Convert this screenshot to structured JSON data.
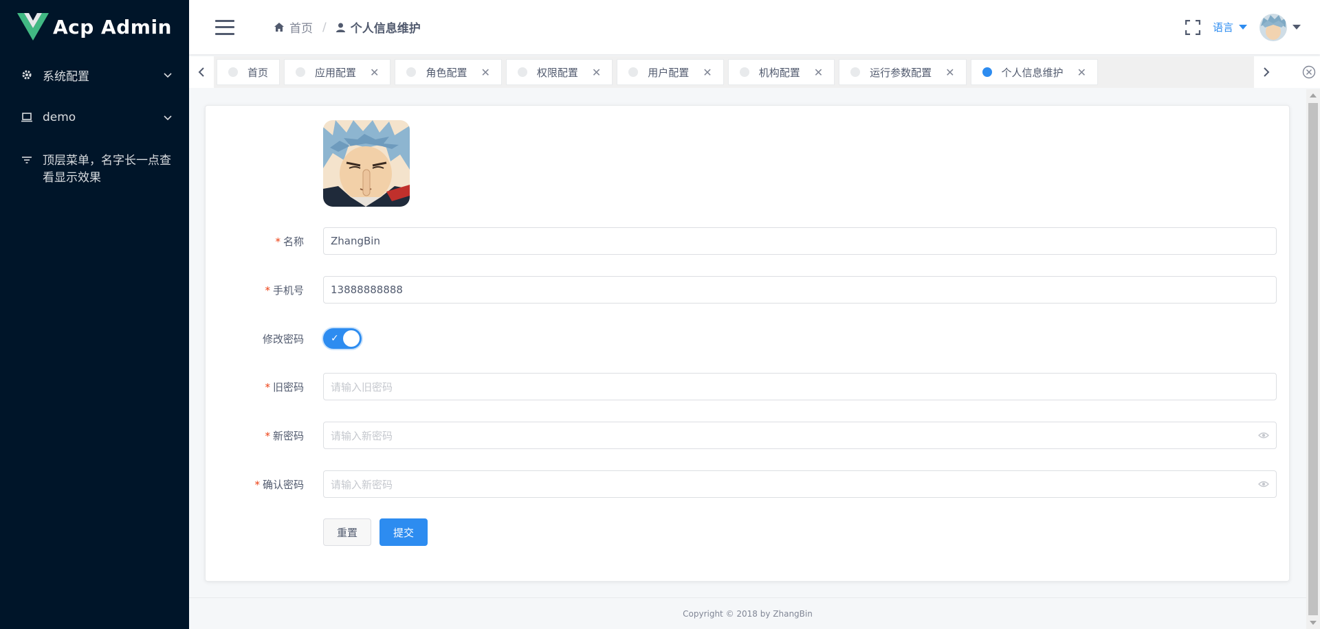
{
  "sidebar": {
    "logo_text": "Acp Admin",
    "logo_icon": "vue-logo",
    "items": [
      {
        "label": "系统配置",
        "icon": "gear-icon"
      },
      {
        "label": "demo",
        "icon": "laptop-icon"
      },
      {
        "label": "顶层菜单，名字长一点查看显示效果",
        "icon": "filter-icon"
      }
    ]
  },
  "header": {
    "breadcrumb": [
      {
        "label": "首页",
        "icon": "home-icon"
      },
      {
        "label": "个人信息维护",
        "icon": "user-icon"
      }
    ],
    "language_label": "语言"
  },
  "tabs": [
    {
      "label": "首页",
      "closable": false,
      "active": false
    },
    {
      "label": "应用配置",
      "closable": true,
      "active": false
    },
    {
      "label": "角色配置",
      "closable": true,
      "active": false
    },
    {
      "label": "权限配置",
      "closable": true,
      "active": false
    },
    {
      "label": "用户配置",
      "closable": true,
      "active": false
    },
    {
      "label": "机构配置",
      "closable": true,
      "active": false
    },
    {
      "label": "运行参数配置",
      "closable": true,
      "active": false
    },
    {
      "label": "个人信息维护",
      "closable": true,
      "active": true
    }
  ],
  "form": {
    "name_label": "名称",
    "name_value": "ZhangBin",
    "mobile_label": "手机号",
    "mobile_value": "13888888888",
    "change_password_label": "修改密码",
    "change_password_on": true,
    "old_password_label": "旧密码",
    "old_password_placeholder": "请输入旧密码",
    "new_password_label": "新密码",
    "new_password_placeholder": "请输入新密码",
    "confirm_password_label": "确认密码",
    "confirm_password_placeholder": "请输入新密码",
    "reset_label": "重置",
    "submit_label": "提交"
  },
  "footer": {
    "copyright": "Copyright © 2018 by ZhangBin"
  },
  "colors": {
    "sidebar_bg": "#001529",
    "primary": "#2d8cf0",
    "required": "#ed4014"
  }
}
